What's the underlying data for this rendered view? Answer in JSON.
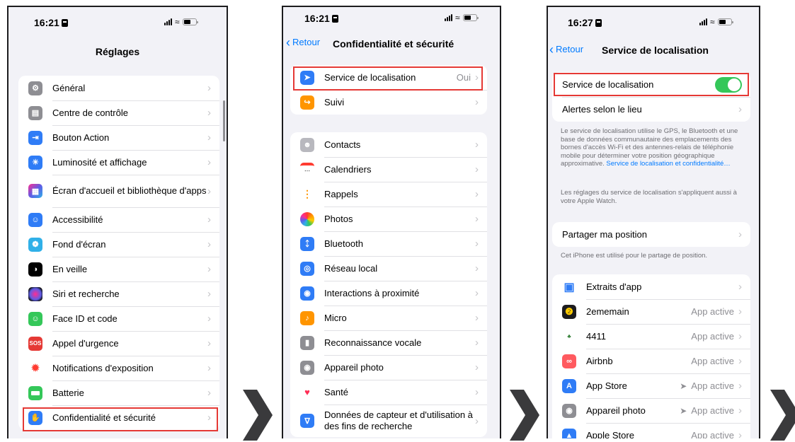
{
  "screen1": {
    "time": "16:21",
    "title": "Réglages",
    "items": [
      {
        "label": "Général",
        "icon": "gear-icon",
        "color": "#8e8e93"
      },
      {
        "label": "Centre de contrôle",
        "icon": "toggles-icon",
        "color": "#8e8e93"
      },
      {
        "label": "Bouton Action",
        "icon": "action-button-icon",
        "color": "#2f7cf6"
      },
      {
        "label": "Luminosité et affichage",
        "icon": "sun-icon",
        "color": "#2f7cf6"
      },
      {
        "label": "Écran d'accueil et bibliothèque d'apps",
        "icon": "home-grid-icon",
        "color": "#5e5ce6"
      },
      {
        "label": "Accessibilité",
        "icon": "accessibility-icon",
        "color": "#2f7cf6"
      },
      {
        "label": "Fond d'écran",
        "icon": "flower-icon",
        "color": "#30b0e8"
      },
      {
        "label": "En veille",
        "icon": "standby-icon",
        "color": "#000000"
      },
      {
        "label": "Siri et recherche",
        "icon": "siri-icon",
        "color": "#222244"
      },
      {
        "label": "Face ID et code",
        "icon": "face-id-icon",
        "color": "#34c759"
      },
      {
        "label": "Appel d'urgence",
        "icon": "sos-icon",
        "color": "#e53935",
        "text": "SOS"
      },
      {
        "label": "Notifications d'exposition",
        "icon": "exposure-icon",
        "color": "#ffffff"
      },
      {
        "label": "Batterie",
        "icon": "battery-icon",
        "color": "#34c759"
      },
      {
        "label": "Confidentialité et sécurité",
        "icon": "hand-icon",
        "color": "#2f7cf6"
      }
    ]
  },
  "screen2": {
    "time": "16:21",
    "back": "Retour",
    "title": "Confidentialité et sécurité",
    "top_items": [
      {
        "label": "Service de localisation",
        "value": "Oui",
        "icon": "location-arrow-icon",
        "color": "#2f7cf6"
      },
      {
        "label": "Suivi",
        "icon": "tracking-icon",
        "color": "#ff9500"
      }
    ],
    "items": [
      {
        "label": "Contacts",
        "icon": "contacts-icon",
        "color": "#b8b8be"
      },
      {
        "label": "Calendriers",
        "icon": "calendar-icon",
        "color": "#ffffff"
      },
      {
        "label": "Rappels",
        "icon": "reminders-icon",
        "color": "#ffffff"
      },
      {
        "label": "Photos",
        "icon": "photos-icon",
        "color": "#ffffff"
      },
      {
        "label": "Bluetooth",
        "icon": "bluetooth-icon",
        "color": "#2f7cf6"
      },
      {
        "label": "Réseau local",
        "icon": "globe-icon",
        "color": "#2f7cf6"
      },
      {
        "label": "Interactions à proximité",
        "icon": "nearby-icon",
        "color": "#2f7cf6"
      },
      {
        "label": "Micro",
        "icon": "microphone-icon",
        "color": "#ff9500"
      },
      {
        "label": "Reconnaissance vocale",
        "icon": "waveform-icon",
        "color": "#8e8e93"
      },
      {
        "label": "Appareil photo",
        "icon": "camera-icon",
        "color": "#8e8e93"
      },
      {
        "label": "Santé",
        "icon": "heart-icon",
        "color": "#ffffff"
      },
      {
        "label": "Données de capteur et d'utilisation à des fins de recherche",
        "icon": "research-icon",
        "color": "#2f7cf6"
      }
    ]
  },
  "screen3": {
    "time": "16:27",
    "back": "Retour",
    "title": "Service de localisation",
    "toggle_label": "Service de localisation",
    "toggle_on": true,
    "alerts_label": "Alertes selon le lieu",
    "description": "Le service de localisation utilise le GPS, le Bluetooth et une base de données communautaire des emplacements des bornes d'accès Wi-Fi et des antennes-relais de téléphonie mobile pour déterminer votre position géographique approximative.",
    "description_link": "Service de localisation et confidentialité…",
    "watch_note": "Les réglages du service de localisation s'appliquent aussi à votre Apple Watch.",
    "share_label": "Partager ma position",
    "share_note": "Cet iPhone est utilisé pour le partage de position.",
    "apps": [
      {
        "label": "Extraits d'app",
        "value": "",
        "icon": "app-clips-icon",
        "color": "#2f7cf6"
      },
      {
        "label": "2ememain",
        "value": "App active",
        "icon": "2ememain-icon",
        "color": "#1c1c1e"
      },
      {
        "label": "4411",
        "value": "App active",
        "icon": "4411-icon",
        "color": "#ffffff"
      },
      {
        "label": "Airbnb",
        "value": "App active",
        "icon": "airbnb-icon",
        "color": "#ff5a5f"
      },
      {
        "label": "App Store",
        "value": "App active",
        "icon": "app-store-icon",
        "color": "#2f7cf6",
        "located": true
      },
      {
        "label": "Appareil photo",
        "value": "App active",
        "icon": "camera-icon",
        "color": "#8e8e93",
        "located": true
      },
      {
        "label": "Apple Store",
        "value": "App active",
        "icon": "apple-store-icon",
        "color": "#2f7cf6"
      }
    ]
  }
}
